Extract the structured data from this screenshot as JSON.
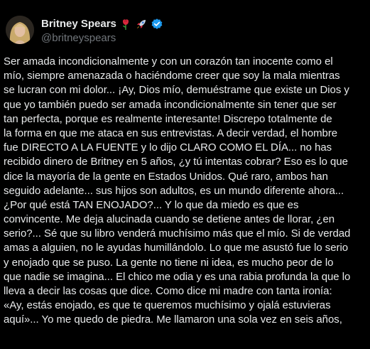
{
  "author": {
    "display_name": "Britney Spears",
    "handle": "@britneyspears",
    "badges": [
      "rose-emoji",
      "rocket-emoji",
      "verified-badge"
    ],
    "verified_color": "#1d9bf0"
  },
  "post": {
    "lines": [
      "Ser amada incondicionalmente y con un corazón tan inocente como el",
      "mío, siempre amenazada o haciéndome creer que soy la mala mientras",
      "se lucran con mi dolor... ¡Ay, Dios mío, demuéstrame que existe un Dios y",
      "que yo también puedo ser amada incondicionalmente sin tener que ser",
      "tan perfecta, porque es realmente interesante! Discrepo totalmente de",
      "la forma en que me ataca en sus entrevistas. A decir verdad, el hombre",
      "fue DIRECTO A LA FUENTE y lo dijo CLARO COMO EL DÍA... no has",
      "recibido dinero de Britney en 5 años, ¿y tú intentas cobrar? Eso es lo que",
      "dice la mayoría de la gente en Estados Unidos. Qué raro, ambos han",
      "seguido adelante... sus hijos son adultos, es un mundo diferente ahora...",
      "¿Por qué está TAN ENOJADO?... Y lo que da miedo es que es",
      "convincente. Me deja alucinada cuando se detiene antes de llorar, ¿en",
      "serio?... Sé que su libro venderá muchísimo más que el mío. Si de verdad",
      "amas a alguien, no le ayudas humillándolo. Lo que me asustó fue lo serio",
      "y enojado que se puso. La gente no tiene ni idea, es mucho peor de lo",
      "que nadie se imagina... El chico me odia y es una rabia profunda la que lo",
      "lleva a decir las cosas que dice. Como dice mi madre con tanta ironía:",
      "«Ay, estás enojado, es que te queremos muchísimo y ojalá estuvieras",
      "aquí»... Yo me quedo de piedra. Me llamaron una sola vez en seis años,"
    ]
  },
  "colors": {
    "background": "#000000",
    "text_primary": "#e7e9ea",
    "text_secondary": "#71767b"
  }
}
